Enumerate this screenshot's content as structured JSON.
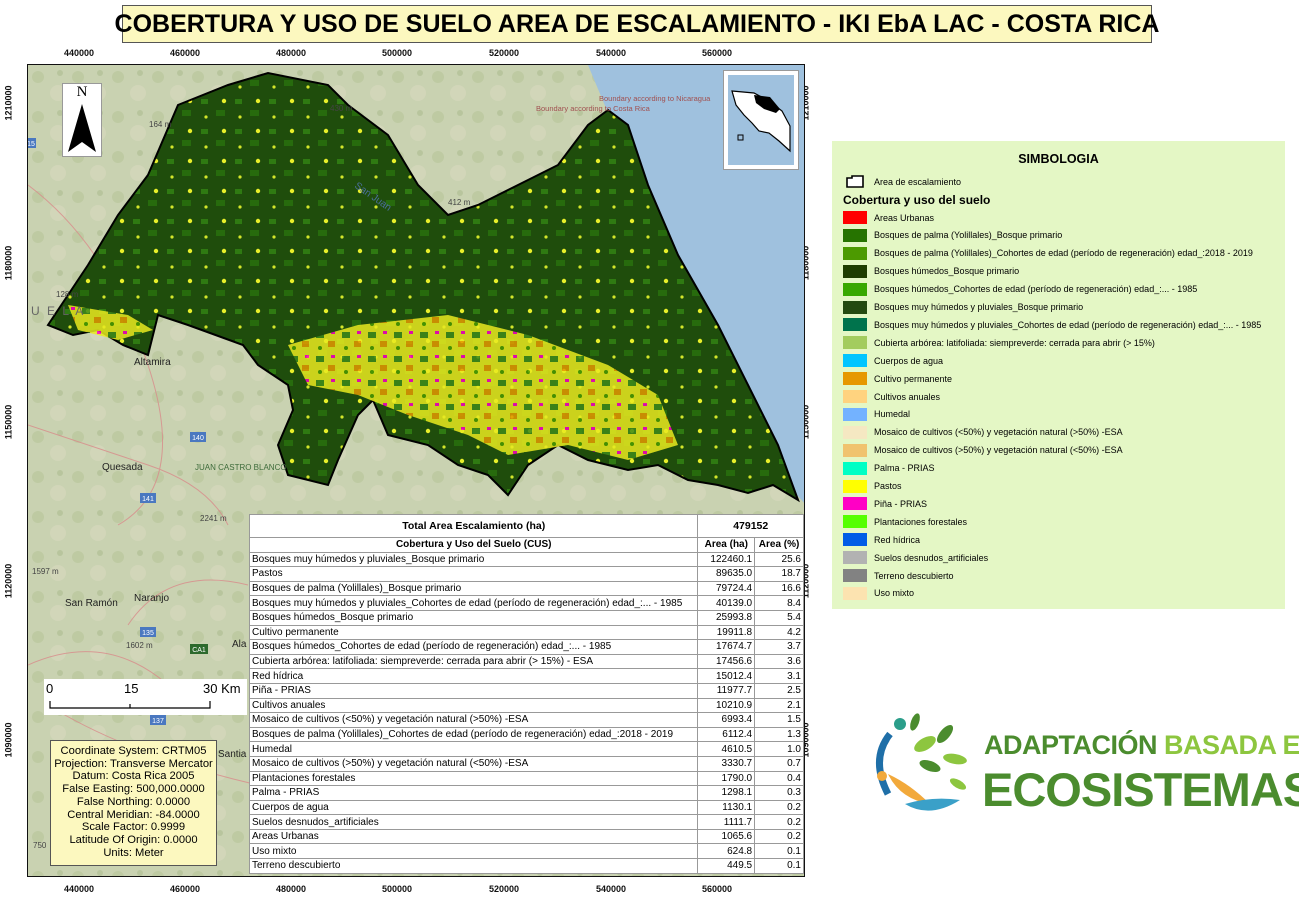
{
  "title": "COBERTURA Y USO DE SUELO AREA DE ESCALAMIENTO - IKI EbA LAC - COSTA RICA",
  "axes": {
    "x_ticks": [
      "440000",
      "460000",
      "480000",
      "500000",
      "520000",
      "540000",
      "560000"
    ],
    "y_ticks": [
      "1210000",
      "1180000",
      "1150000",
      "1120000",
      "1090000"
    ]
  },
  "north_label": "N",
  "map_labels": {
    "boundary_nic": "Boundary according to Nicaragua",
    "boundary_cr": "Boundary according to Costa Rica",
    "altamira": "Altamira",
    "quesada": "Quesada",
    "naranjo": "Naranjo",
    "san_ramon": "San Ramón",
    "juan_castro": "JUAN CASTRO BLANCO",
    "alaj": "Ala",
    "santia": "Santia",
    "ela": "U E L A",
    "elev_164": "164 m",
    "elev_128": "128 m",
    "elev_430": "430 m",
    "elev_412": "412 m",
    "elev_2241": "2241 m",
    "elev_1597": "1597 m",
    "elev_1602": "1602 m",
    "elev_750": "750",
    "river_sanjuan": "San Juan",
    "route_140": "140",
    "route_141": "141",
    "route_135": "135",
    "route_137": "137",
    "route_ca1": "CA1",
    "route_15": "15"
  },
  "scale_bar": {
    "l0": "0",
    "l1": "15",
    "l2": "30 Km"
  },
  "coordinate_system": [
    "Coordinate System: CRTM05",
    "Projection: Transverse Mercator",
    "Datum: Costa Rica 2005",
    "False Easting: 500,000.0000",
    "False Northing: 0.0000",
    "Central Meridian: -84.0000",
    "Scale Factor: 0.9999",
    "Latitude Of Origin: 0.0000",
    "Units: Meter"
  ],
  "table": {
    "total_label": "Total Area Escalamiento (ha)",
    "total_value": "479152",
    "col_cus": "Cobertura y Uso del Suelo (CUS)",
    "col_area": "Area (ha)",
    "col_pct": "Area (%)",
    "rows": [
      {
        "name": "Bosques muy húmedos y pluviales_Bosque primario",
        "area": "122460.1",
        "pct": "25.6"
      },
      {
        "name": "Pastos",
        "area": "89635.0",
        "pct": "18.7"
      },
      {
        "name": "Bosques de palma (Yolillales)_Bosque primario",
        "area": "79724.4",
        "pct": "16.6"
      },
      {
        "name": "Bosques muy húmedos y pluviales_Cohortes de edad  (período de regeneración) edad_:... - 1985",
        "area": "40139.0",
        "pct": "8.4"
      },
      {
        "name": "Bosques húmedos_Bosque primario",
        "area": "25993.8",
        "pct": "5.4"
      },
      {
        "name": "Cultivo permanente",
        "area": "19911.8",
        "pct": "4.2"
      },
      {
        "name": "Bosques húmedos_Cohortes de edad  (período de regeneración) edad_:... - 1985",
        "area": "17674.7",
        "pct": "3.7"
      },
      {
        "name": "Cubierta arbórea: latifoliada: siempreverde: cerrada para abrir (> 15%) - ESA",
        "area": "17456.6",
        "pct": "3.6"
      },
      {
        "name": "Red hídrica",
        "area": "15012.4",
        "pct": "3.1"
      },
      {
        "name": "Piña - PRIAS",
        "area": "11977.7",
        "pct": "2.5"
      },
      {
        "name": "Cultivos anuales",
        "area": "10210.9",
        "pct": "2.1"
      },
      {
        "name": "Mosaico de cultivos (<50%) y vegetación natural (>50%) -ESA",
        "area": "6993.4",
        "pct": "1.5"
      },
      {
        "name": "Bosques de palma (Yolillales)_Cohortes de edad  (período de regeneración) edad_:2018 - 2019",
        "area": "6112.4",
        "pct": "1.3"
      },
      {
        "name": "Humedal",
        "area": "4610.5",
        "pct": "1.0"
      },
      {
        "name": "Mosaico de cultivos (>50%) y vegetación natural (<50%) -ESA",
        "area": "3330.7",
        "pct": "0.7"
      },
      {
        "name": "Plantaciones forestales",
        "area": "1790.0",
        "pct": "0.4"
      },
      {
        "name": "Palma - PRIAS",
        "area": "1298.1",
        "pct": "0.3"
      },
      {
        "name": "Cuerpos de agua",
        "area": "1130.1",
        "pct": "0.2"
      },
      {
        "name": "Suelos desnudos_artificiales",
        "area": "1111.7",
        "pct": "0.2"
      },
      {
        "name": "Areas Urbanas",
        "area": "1065.6",
        "pct": "0.2"
      },
      {
        "name": "Uso mixto",
        "area": "624.8",
        "pct": "0.1"
      },
      {
        "name": "Terreno descubierto",
        "area": "449.5",
        "pct": "0.1"
      }
    ]
  },
  "legend": {
    "title": "SIMBOLOGIA",
    "area_label": "Area de escalamiento",
    "subtitle": "Cobertura y uso del suelo",
    "items": [
      {
        "label": "Areas Urbanas",
        "color": "#ff0000"
      },
      {
        "label": "Bosques de palma (Yolillales)_Bosque primario",
        "color": "#267300"
      },
      {
        "label": "Bosques de palma (Yolillales)_Cohortes de edad  (período de regeneración) edad_:2018 - 2019",
        "color": "#4c9a00"
      },
      {
        "label": "Bosques húmedos_Bosque primario",
        "color": "#1e3d00"
      },
      {
        "label": "Bosques húmedos_Cohortes de edad  (período de regeneración) edad_:... - 1985",
        "color": "#38a800"
      },
      {
        "label": "Bosques muy húmedos y pluviales_Bosque primario",
        "color": "#244a10"
      },
      {
        "label": "Bosques muy húmedos y pluviales_Cohortes de edad  (período de regeneración) edad_:... - 1985",
        "color": "#00734c"
      },
      {
        "label": "Cubierta arbórea: latifoliada: siempreverde: cerrada para abrir (> 15%)",
        "color": "#a3cc5e"
      },
      {
        "label": "Cuerpos de agua",
        "color": "#00c5ff"
      },
      {
        "label": "Cultivo permanente",
        "color": "#e69800"
      },
      {
        "label": "Cultivos anuales",
        "color": "#ffd37f"
      },
      {
        "label": "Humedal",
        "color": "#73b2ff"
      },
      {
        "label": "Mosaico de cultivos (<50%) y vegetación natural (>50%) -ESA",
        "color": "#f5e8c2"
      },
      {
        "label": "Mosaico de cultivos (>50%) y vegetación natural (<50%) -ESA",
        "color": "#f0c36e"
      },
      {
        "label": "Palma - PRIAS",
        "color": "#00ffc5"
      },
      {
        "label": "Pastos",
        "color": "#ffff00"
      },
      {
        "label": "Piña - PRIAS",
        "color": "#ff00c5"
      },
      {
        "label": "Plantaciones forestales",
        "color": "#55ff00"
      },
      {
        "label": "Red hídrica",
        "color": "#005ce6"
      },
      {
        "label": "Suelos desnudos_artificiales",
        "color": "#b2b2b2"
      },
      {
        "label": "Terreno descubierto",
        "color": "#828282"
      },
      {
        "label": "Uso mixto",
        "color": "#fce3b0"
      }
    ]
  },
  "logo": {
    "line1a": "ADAPTACIÓN",
    "line1b": "BASADA EN",
    "line2": "ECOSISTEMAS",
    "color_dark": "#4b8c2e",
    "color_light": "#8dc63f"
  }
}
